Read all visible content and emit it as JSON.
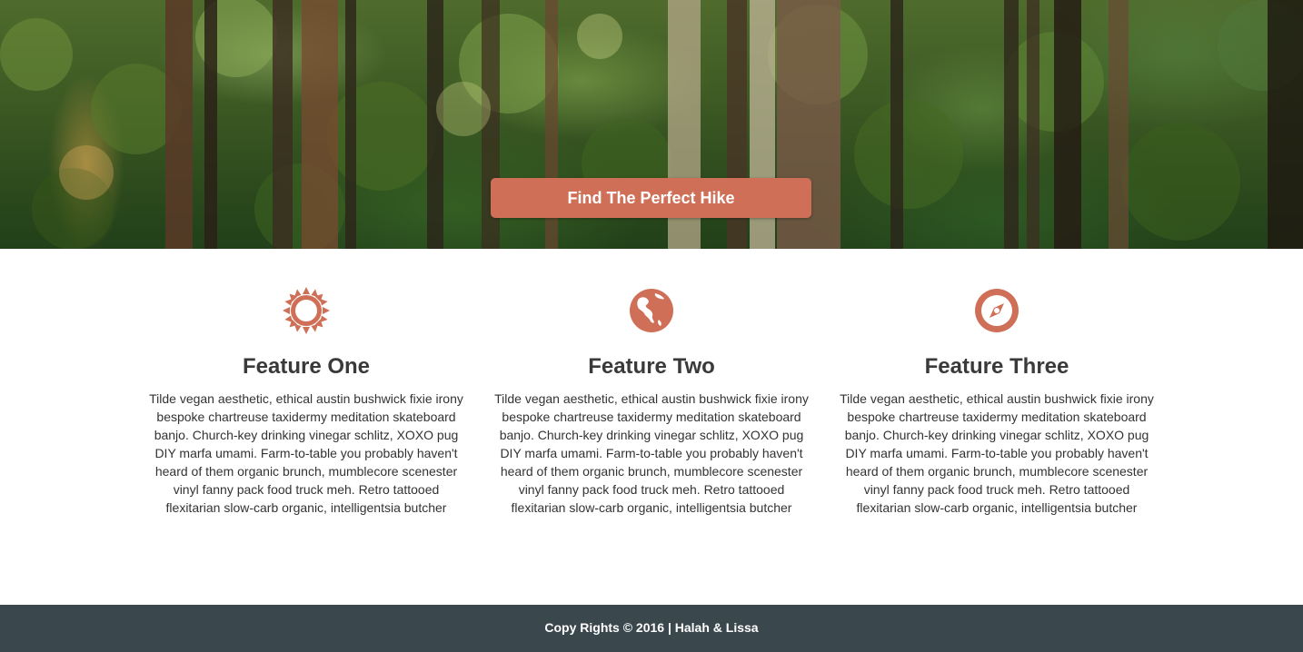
{
  "hero": {
    "cta_label": "Find The Perfect Hike"
  },
  "features": [
    {
      "icon": "sun-icon",
      "title": "Feature One",
      "body": "Tilde vegan aesthetic, ethical austin bushwick fixie irony bespoke chartreuse taxidermy meditation skateboard banjo. Church-key drinking vinegar schlitz, XOXO pug DIY marfa umami. Farm-to-table you probably haven't heard of them organic brunch, mumblecore scenester vinyl fanny pack food truck meh. Retro tattooed flexitarian slow-carb organic, intelligentsia butcher"
    },
    {
      "icon": "globe-icon",
      "title": "Feature Two",
      "body": "Tilde vegan aesthetic, ethical austin bushwick fixie irony bespoke chartreuse taxidermy meditation skateboard banjo. Church-key drinking vinegar schlitz, XOXO pug DIY marfa umami. Farm-to-table you probably haven't heard of them organic brunch, mumblecore scenester vinyl fanny pack food truck meh. Retro tattooed flexitarian slow-carb organic, intelligentsia butcher"
    },
    {
      "icon": "compass-icon",
      "title": "Feature Three",
      "body": "Tilde vegan aesthetic, ethical austin bushwick fixie irony bespoke chartreuse taxidermy meditation skateboard banjo. Church-key drinking vinegar schlitz, XOXO pug DIY marfa umami. Farm-to-table you probably haven't heard of them organic brunch, mumblecore scenester vinyl fanny pack food truck meh. Retro tattooed flexitarian slow-carb organic, intelligentsia butcher"
    }
  ],
  "footer": {
    "text": "Copy Rights © 2016 | Halah & Lissa"
  },
  "colors": {
    "accent": "#cf6f58",
    "footer_bg": "#3a474d",
    "heading": "#3a3a3a",
    "body_text": "#333333"
  }
}
